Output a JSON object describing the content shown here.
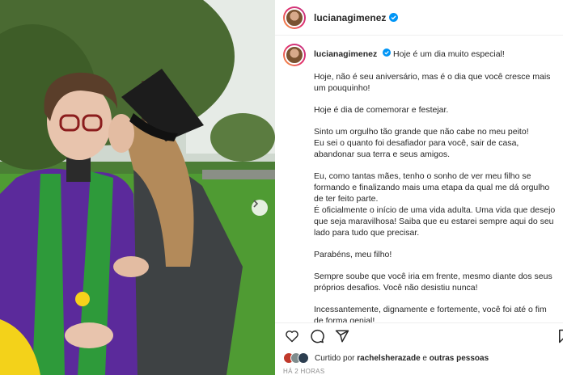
{
  "post": {
    "username": "lucianagimenez",
    "verified": true,
    "caption_first_line": "Hoje é um dia muito especial!",
    "caption_paragraphs": [
      "Hoje, não é seu aniversário, mas é o dia que você cresce mais um pouquinho!",
      "Hoje é dia de comemorar e festejar.",
      "Sinto um orgulho tão grande que não cabe no meu peito!\nEu sei o quanto foi desafiador para você, sair de casa, abandonar sua terra e seus amigos.",
      "Eu, como tantas mães, tenho o sonho de ver meu filho se formando e finalizando mais uma etapa da qual me dá orgulho de ter feito parte.\nÉ oficialmente o início de uma vida adulta. Uma vida que desejo que seja maravilhosa! Saiba que eu estarei sempre aqui do seu lado para tudo que precisar.",
      "Parabéns, meu filho!",
      "Sempre soube que você iria em frente, mesmo diante dos seus próprios desafios. Você não desistiu nunca!",
      "Incessantemente, dignamente e fortemente, você foi até o fim de forma genial!"
    ],
    "likes_prefix": "Curtido por",
    "likes_user": "rachelsherazade",
    "likes_connector": "e",
    "likes_others": "outras pessoas",
    "timestamp": "HÁ 2 HORAS"
  },
  "icons": {
    "verified": "verified-badge-icon",
    "like": "heart-icon",
    "comment": "comment-icon",
    "share": "share-icon",
    "save": "bookmark-icon",
    "next": "chevron-right-icon"
  },
  "colors": {
    "verified": "#0095f6",
    "gown": "#5b2a9b",
    "stole": "#2e9a3a",
    "text": "#262626",
    "muted": "#8e8e8e"
  }
}
